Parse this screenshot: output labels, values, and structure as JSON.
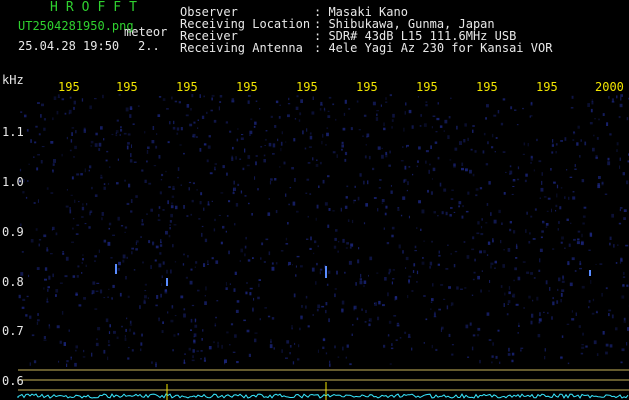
{
  "header": {
    "brand": "HROFFT",
    "filename": "UT2504281950.png",
    "tag": "meteor",
    "datetime": "25.04.28 19:50",
    "page_indicator": "2..",
    "fields": [
      {
        "label": "Observer",
        "value": ": Masaki Kano"
      },
      {
        "label": "Receiving Location",
        "value": ": Shibukawa, Gunma, Japan"
      },
      {
        "label": "Receiver",
        "value": ": SDR# 43dB L15 111.6MHz USB"
      },
      {
        "label": "Receiving Antenna",
        "value": ": 4ele Yagi Az 230 for Kansai VOR"
      }
    ]
  },
  "axis": {
    "y_unit": "kHz",
    "x_ticks": [
      "195",
      "195",
      "195",
      "195",
      "195",
      "195",
      "195",
      "195",
      "195",
      "2000"
    ],
    "y_ticks": [
      "1.1",
      "1.0",
      "0.9",
      "0.8",
      "0.7",
      "0.6"
    ]
  },
  "colors": {
    "background": "#000000",
    "label_green": "#2fd12f",
    "tick_yellow": "#f2e600",
    "signal_cyan": "#38e8ff",
    "noise_blue": "#1e2a8a"
  }
}
